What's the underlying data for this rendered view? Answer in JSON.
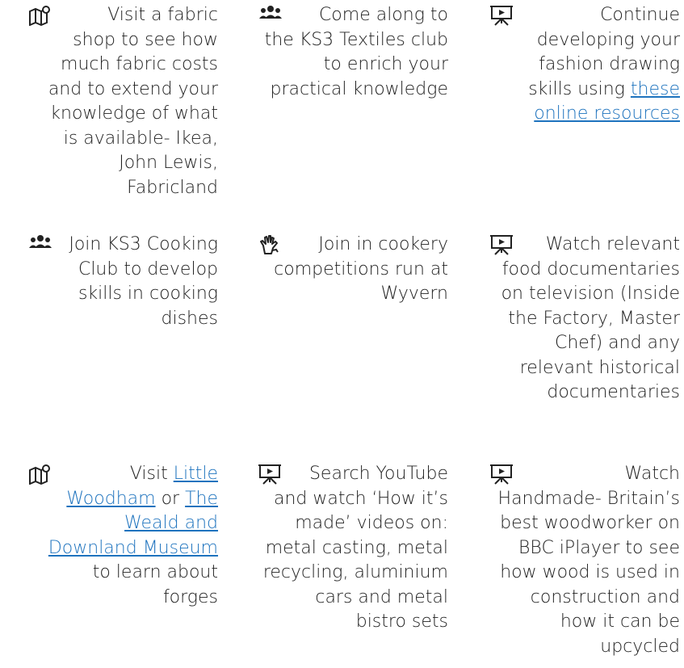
{
  "cells": {
    "r1c1": {
      "icon": "map-icon",
      "lines": [
        "Visit a fabric",
        "shop to see how",
        "much fabric costs",
        "and to extend your",
        "knowledge of what",
        "is available- Ikea,",
        "John Lewis,",
        "Fabricland"
      ]
    },
    "r1c2": {
      "icon": "group-icon",
      "lines": [
        "Come along to",
        "the KS3 Textiles club",
        "to enrich your",
        "practical knowledge"
      ]
    },
    "r1c3": {
      "icon": "presentation-icon",
      "lines": [
        "Continue",
        "developing your",
        "fashion drawing",
        "skills using"
      ],
      "link1": "these",
      "link2": "online resources"
    },
    "r2c1": {
      "icon": "group-icon",
      "lines": [
        "Join KS3 Cooking",
        "Club to develop",
        "skills in cooking",
        "dishes"
      ]
    },
    "r2c2": {
      "icon": "sign-language-icon",
      "lines": [
        "Join in cookery",
        "competitions run at",
        "Wyvern"
      ]
    },
    "r2c3": {
      "icon": "presentation-icon",
      "lines": [
        "Watch relevant",
        "food documentaries",
        "on television (Inside",
        "the Factory, Master",
        "Chef) and any",
        "relevant historical",
        "documentaries"
      ]
    },
    "r3c1": {
      "icon": "map-icon",
      "visit": "Visit",
      "link_a": "Little",
      "link_b": "Woodham",
      "or": "or",
      "link_c": "The",
      "link_d": "Weald and",
      "link_e": "Downland Museum",
      "lines": [
        "to learn about",
        "forges"
      ]
    },
    "r3c2": {
      "icon": "presentation-icon",
      "lines": [
        "Search YouTube",
        "and watch ‘How it’s",
        "made’ videos on:",
        "metal casting, metal",
        "recycling, aluminium",
        "cars and metal",
        "bistro sets"
      ]
    },
    "r3c3": {
      "icon": "presentation-icon",
      "lines": [
        "Watch",
        "Handmade- Britain’s",
        "best woodworker on",
        "BBC iPlayer to see",
        "how wood is used in",
        "construction and",
        "how it can be",
        "upcycled"
      ]
    }
  },
  "colors": {
    "text": "#222222",
    "link": "#1e73be"
  }
}
